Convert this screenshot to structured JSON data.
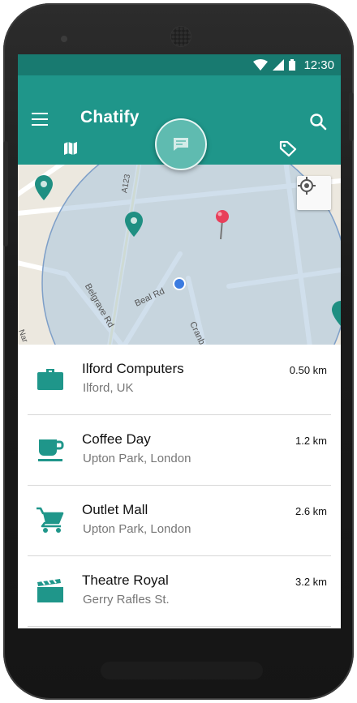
{
  "status_bar": {
    "time": "12:30"
  },
  "app_bar": {
    "title": "Chatify"
  },
  "tabs": [
    {
      "id": "map",
      "icon": "map-icon",
      "active": true
    },
    {
      "id": "chat",
      "icon": "chat-bubble-icon",
      "active": false
    },
    {
      "id": "tags",
      "icon": "tag-icon",
      "active": false
    }
  ],
  "map": {
    "road_labels": [
      "A123",
      "Belgrave Rd",
      "Beal Rd",
      "Cranb",
      "Nar"
    ]
  },
  "places": [
    {
      "name": "Ilford Computers",
      "address": "Ilford, UK",
      "distance": "0.50 km",
      "icon": "briefcase-icon"
    },
    {
      "name": "Coffee Day",
      "address": "Upton Park, London",
      "distance": "1.2 km",
      "icon": "coffee-cup-icon"
    },
    {
      "name": "Outlet Mall",
      "address": "Upton Park, London",
      "distance": "2.6 km",
      "icon": "shopping-cart-icon"
    },
    {
      "name": "Theatre Royal",
      "address": "Gerry Rafles St.",
      "distance": "3.2 km",
      "icon": "clapperboard-icon"
    }
  ],
  "colors": {
    "primary": "#1f968a",
    "primary_dark": "#187a70",
    "accent_icon": "#1f968a",
    "fab": "#5fbbb0"
  }
}
